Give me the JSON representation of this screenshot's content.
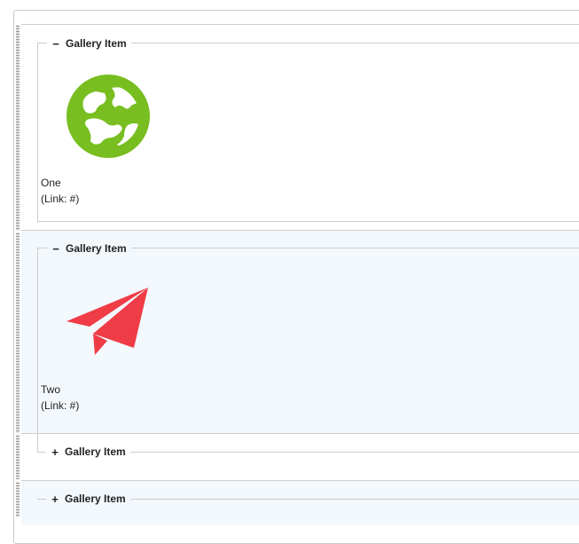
{
  "items": [
    {
      "legend": "Gallery Item",
      "toggle": "−",
      "expanded": true,
      "title": "One",
      "link": "(Link: #)",
      "icon": "globe-icon",
      "icon_color": "#78be20"
    },
    {
      "legend": "Gallery Item",
      "toggle": "−",
      "expanded": true,
      "title": "Two",
      "link": "(Link: #)",
      "icon": "paper-plane-icon",
      "icon_color": "#f03c46"
    },
    {
      "legend": "Gallery Item",
      "toggle": "+",
      "expanded": false
    },
    {
      "legend": "Gallery Item",
      "toggle": "+",
      "expanded": false
    }
  ]
}
